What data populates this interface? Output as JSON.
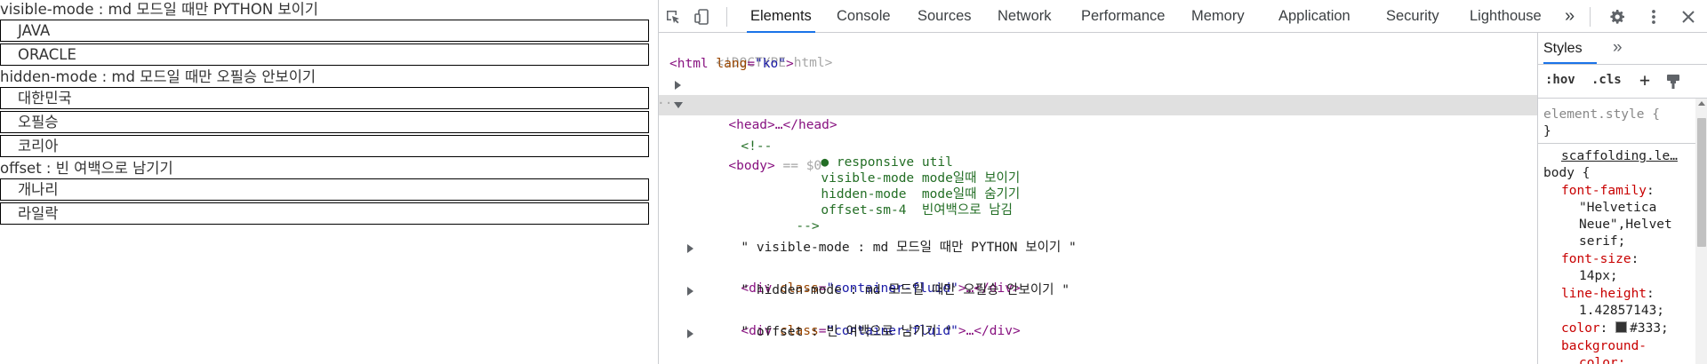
{
  "viewport": {
    "sections": [
      {
        "label": "visible-mode : md 모드일 때만 PYTHON 보이기",
        "boxes": [
          "JAVA",
          "ORACLE"
        ]
      },
      {
        "label": "hidden-mode : md 모드일 때만 오필승 안보이기",
        "boxes": [
          "대한민국",
          "오필승",
          "코리아"
        ]
      },
      {
        "label": "offset : 빈 여백으로 남기기",
        "boxes": [
          "개나리",
          "라일락"
        ]
      }
    ]
  },
  "devtools": {
    "tabs": [
      "Elements",
      "Console",
      "Sources",
      "Network",
      "Performance",
      "Memory",
      "Application",
      "Security",
      "Lighthouse"
    ],
    "active_tab": "Elements",
    "more_tabs": "»",
    "icons": [
      "inspect-element-icon",
      "device-toolbar-icon",
      "gear-icon",
      "kebab-menu-icon",
      "close-icon"
    ],
    "accent_color": "#1a73e8",
    "dom": {
      "doctype": "<!DOCTYPE html>",
      "html_open": "<html",
      "html_attr": "lang",
      "html_val": "\"ko\"",
      "html_close": ">",
      "head": "<head>…</head>",
      "body_ellipsis": "···",
      "body": "<body>",
      "body_marker": "== $0",
      "comment_open": "<!--",
      "comment_lines": [
        "● responsive util",
        "visible-mode mode일때 보이기",
        "hidden-mode  mode일때 숨기기",
        "offset-sm-4  빈여백으로 남김"
      ],
      "comment_close": "-->",
      "text_nodes": [
        "\" visible-mode : md 모드일 때만 PYTHON 보이기 \"",
        "\" hidden-mode : md 모드일 때만 오필승 안보이기 \"",
        "\" offset : 빈 여백으로 남기기 \""
      ],
      "div_open": "<div",
      "div_attr": "class",
      "div_val": "\"container-fluid\"",
      "div_rest": ">…</div>"
    },
    "styles": {
      "tab_label": "Styles",
      "more": "»",
      "hov": ":hov",
      "cls": ".cls",
      "plus": "+",
      "element_style": "element.style {",
      "close_brace": "}",
      "source_link": "scaffolding.le…",
      "selector": "body {",
      "decls": [
        {
          "prop": "font-family",
          "value": "\"Helvetica"
        },
        {
          "prop": "",
          "value": "Neue\",Helvet"
        },
        {
          "prop": "",
          "value": "serif;"
        },
        {
          "prop": "font-size",
          "value": "14px;"
        },
        {
          "prop": "line-height",
          "value": "1.42857143;"
        },
        {
          "prop": "color",
          "value": "#333;"
        },
        {
          "prop": "background-",
          "value": "color:"
        }
      ]
    }
  }
}
